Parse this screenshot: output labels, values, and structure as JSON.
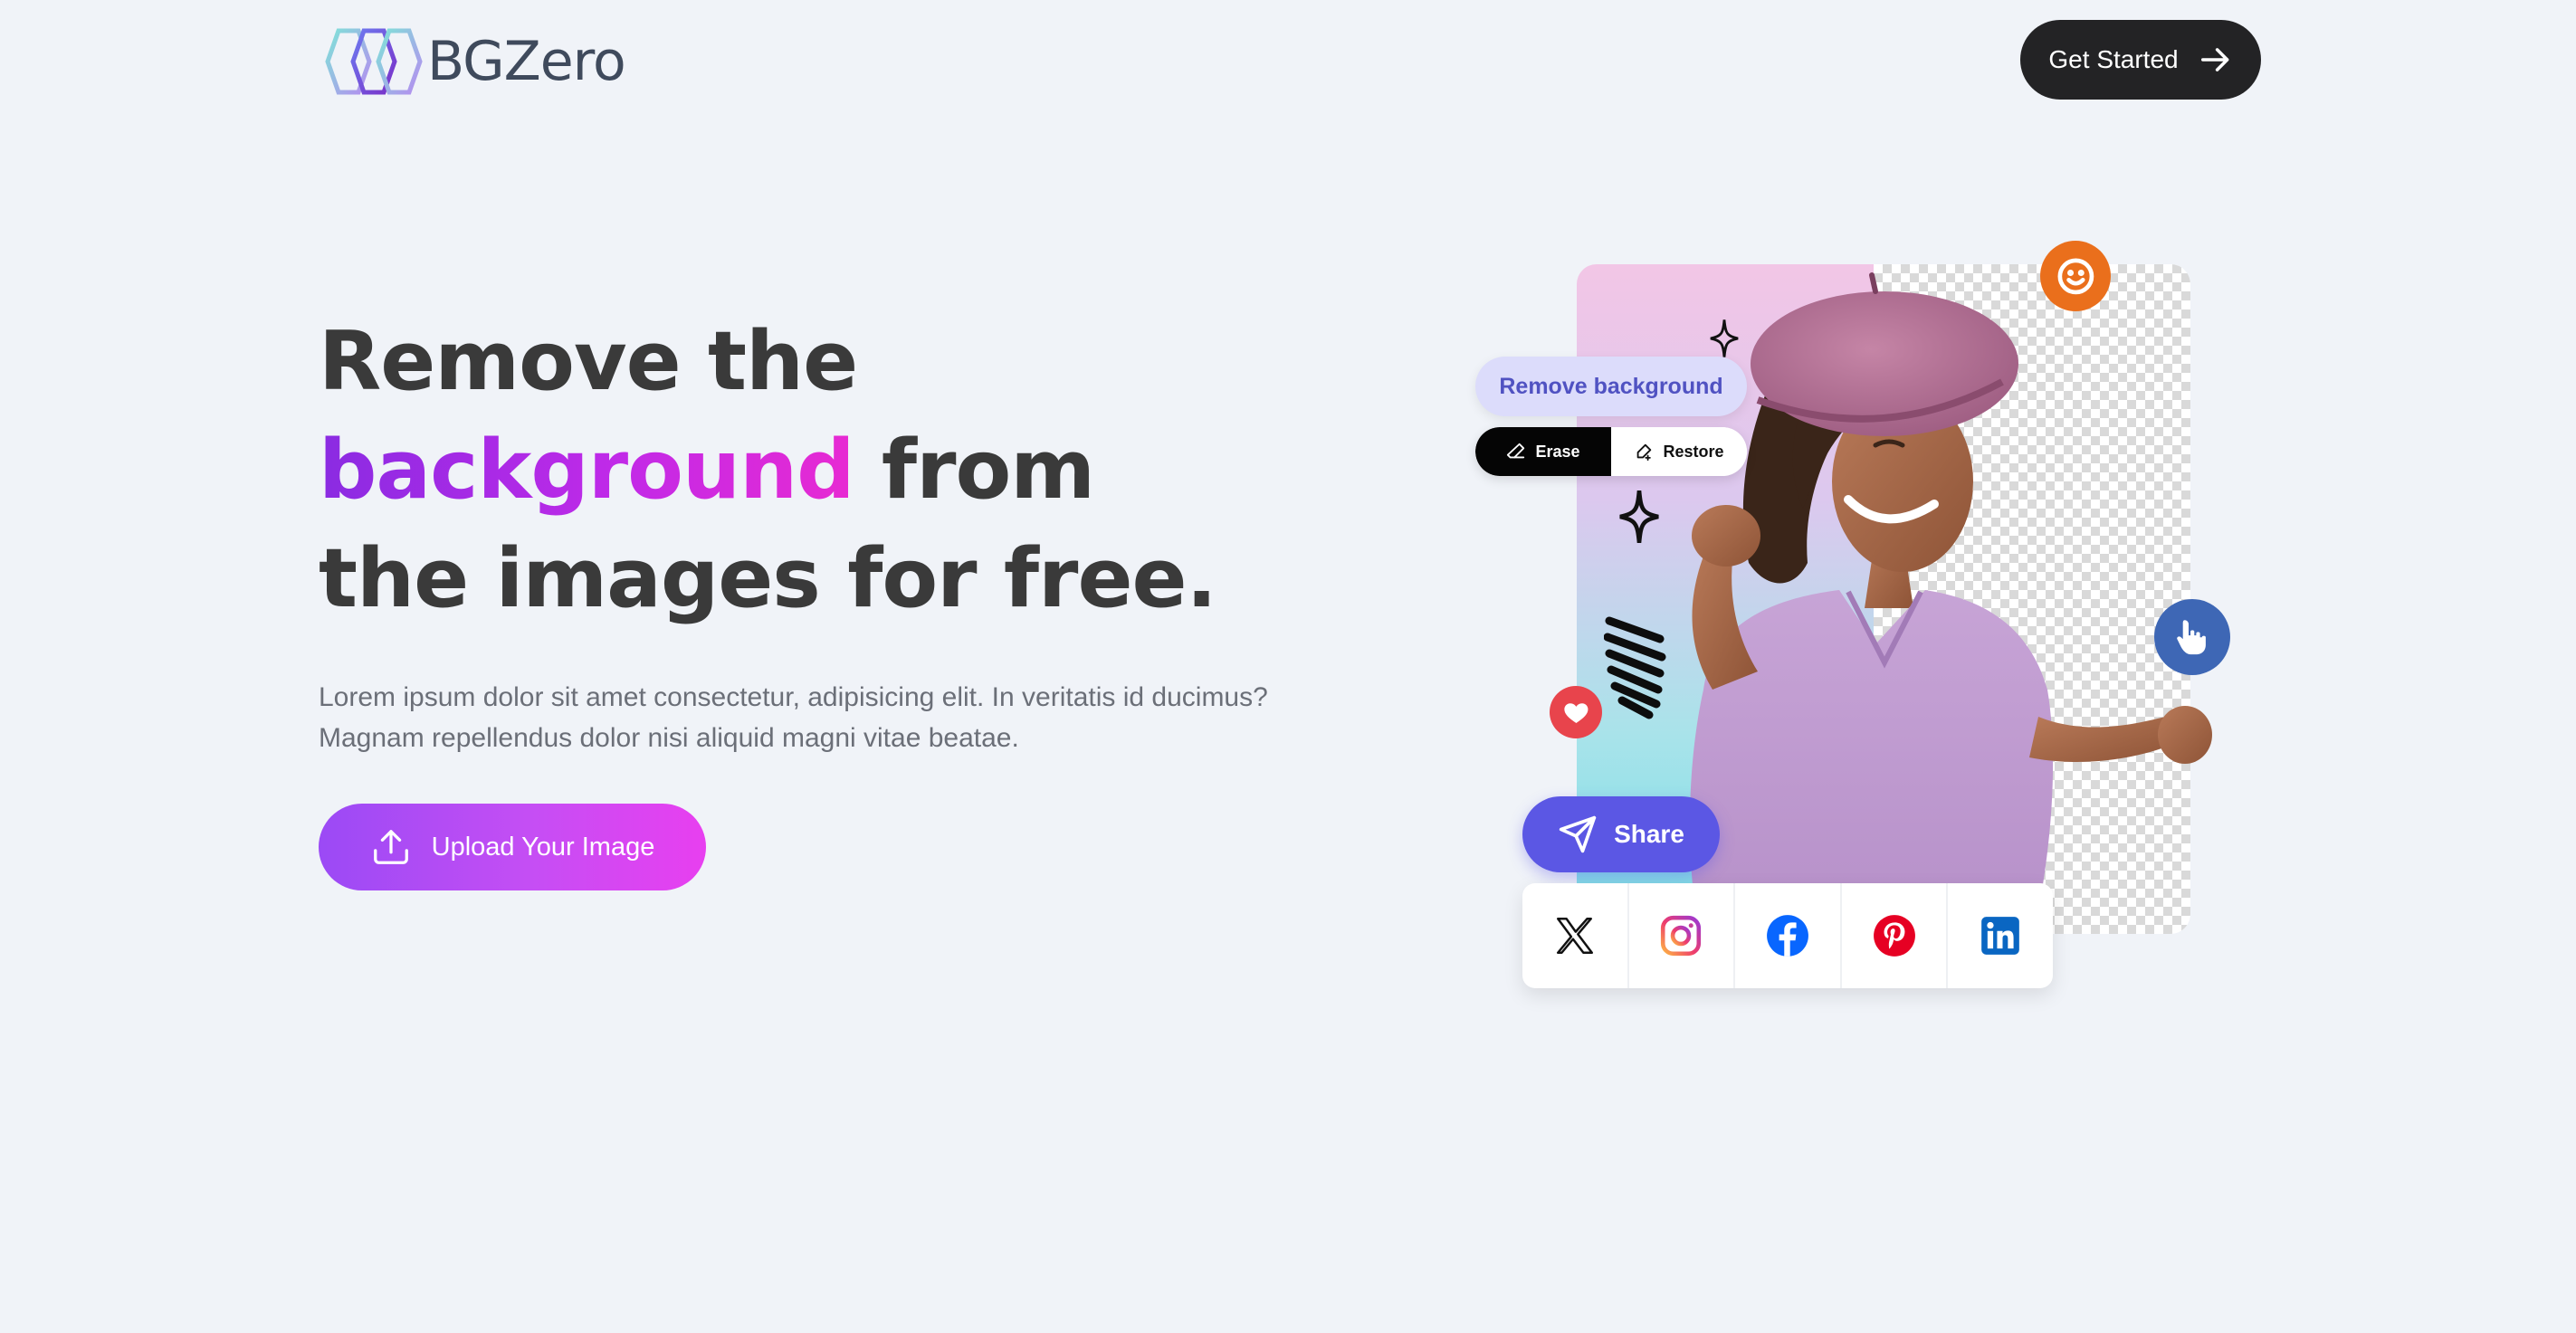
{
  "header": {
    "logo_text": "BGZero",
    "cta_label": "Get Started"
  },
  "hero": {
    "title_line1": "Remove the",
    "title_highlight": "background",
    "title_line2_rest": " from",
    "title_line3": "the images for free.",
    "subtitle_line1": "Lorem ipsum dolor sit amet consectetur, adipisicing elit. In veritatis id ducimus?",
    "subtitle_line2": "Magnam repellendus dolor nisi aliquid magni vitae beatae.",
    "upload_label": "Upload Your Image"
  },
  "illustration": {
    "remove_bg_label": "Remove background",
    "erase_label": "Erase",
    "restore_label": "Restore",
    "share_label": "Share",
    "socials": [
      "x-icon",
      "instagram-icon",
      "facebook-icon",
      "pinterest-icon",
      "linkedin-icon"
    ]
  },
  "colors": {
    "background": "#f0f3f8",
    "accent_gradient_start": "#8a2be2",
    "accent_gradient_end": "#e82ad2",
    "dark_button": "#232325",
    "share_button": "#5b57e4"
  }
}
